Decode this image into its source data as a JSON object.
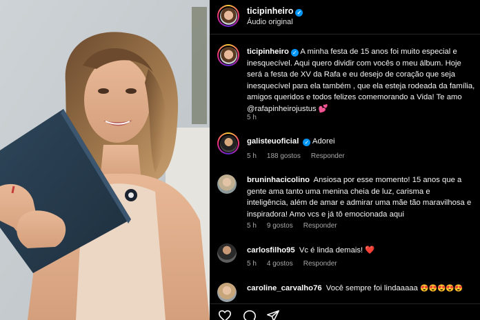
{
  "header": {
    "username": "ticipinheiro",
    "subtitle": "Áudio original"
  },
  "caption": {
    "username": "ticipinheiro",
    "text": "A minha festa de 15 anos foi muito especial e inesquecível. Aqui quero dividir com vocês o meu álbum. Hoje será a festa de XV da Rafa e eu desejo de coração que seja inesquecível para ela também , que ela esteja rodeada da família, amigos queridos e todos felizes comemorando a Vida! Te amo @rafapinheirojustus",
    "emoji": "💕",
    "time": "5 h"
  },
  "comments": [
    {
      "username": "galisteuoficial",
      "text": "Adorei",
      "time": "5 h",
      "likes": "188 gostos",
      "reply": "Responder"
    },
    {
      "username": "bruninhacicolino",
      "text": "Ansiosa por esse momento! 15 anos que a gente ama tanto uma menina cheia de luz, carisma e inteligência, além de amar e admirar uma mãe tão maravilhosa e inspiradora! Amo vcs e já tô emocionada aqui",
      "time": "5 h",
      "likes": "9 gostos",
      "reply": "Responder"
    },
    {
      "username": "carlosfilho95",
      "text": "Vc é linda demais!",
      "emoji": "❤️",
      "time": "5 h",
      "likes": "4 gostos",
      "reply": "Responder"
    },
    {
      "username": "caroline_carvalho76",
      "text": "Você sempre foi lindaaaaa",
      "emoji": "😍😍😍😍😍"
    }
  ],
  "icons": {
    "verified": "verified-badge-icon",
    "like": "heart-outline-icon",
    "comment": "comment-bubble-icon",
    "share": "paper-plane-icon"
  },
  "colors": {
    "verified": "#0095f6",
    "background": "#000000",
    "muted_text": "#a8a8a8"
  }
}
